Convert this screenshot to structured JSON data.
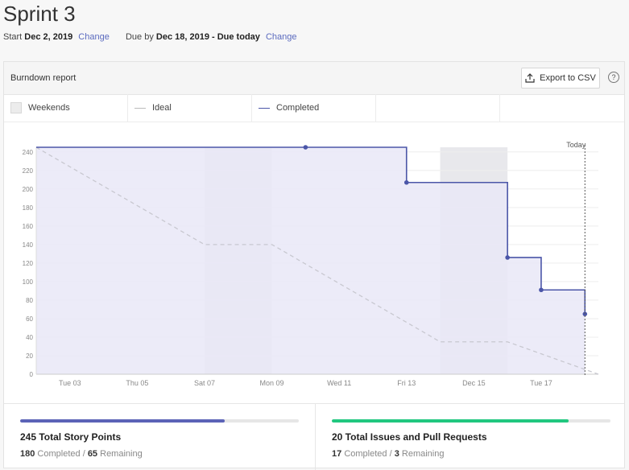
{
  "page": {
    "title": "Sprint 3",
    "start_label": "Start",
    "start_date": "Dec 2, 2019",
    "change_start": "Change",
    "due_label": "Due by",
    "due_date": "Dec 18, 2019 - Due today",
    "change_due": "Change"
  },
  "report": {
    "title": "Burndown report",
    "export_label": "Export to CSV",
    "help_glyph": "?"
  },
  "legend": {
    "weekends": "Weekends",
    "ideal": "Ideal",
    "completed": "Completed"
  },
  "chart_data": {
    "type": "line",
    "today_label": "Today",
    "ylim": [
      0,
      245
    ],
    "y_ticks": [
      0,
      20,
      40,
      60,
      80,
      100,
      120,
      140,
      160,
      180,
      200,
      220,
      240
    ],
    "x_tick_labels": [
      "Tue 03",
      "Thu 05",
      "Sat 07",
      "Mon 09",
      "Wed 11",
      "Fri 13",
      "Dec 15",
      "Tue 17"
    ],
    "x_tick_days": [
      1,
      3,
      5,
      7,
      9,
      11,
      13,
      15
    ],
    "x_range_days": [
      0,
      16.7
    ],
    "today_day": 16.3,
    "weekends": [
      [
        5,
        7
      ],
      [
        12,
        14
      ]
    ],
    "ideal": {
      "name": "Ideal",
      "points": [
        [
          0,
          245
        ],
        [
          5,
          140
        ],
        [
          7,
          140
        ],
        [
          12,
          35
        ],
        [
          14,
          35
        ],
        [
          16.7,
          0
        ]
      ]
    },
    "completed": {
      "name": "Completed",
      "steps": [
        [
          0,
          245
        ],
        [
          8,
          245
        ],
        [
          11,
          245
        ],
        [
          11,
          207
        ],
        [
          14,
          207
        ],
        [
          14,
          126
        ],
        [
          15,
          126
        ],
        [
          15,
          91
        ],
        [
          16,
          91
        ],
        [
          16.3,
          91
        ],
        [
          16.3,
          65
        ]
      ],
      "markers": [
        [
          8,
          245
        ],
        [
          11,
          207
        ],
        [
          14,
          126
        ],
        [
          15,
          91
        ],
        [
          16.3,
          65
        ]
      ]
    },
    "colors": {
      "completed": "#4b56a8",
      "completed_fill": "#e9e8f7",
      "ideal": "#c8c8d0",
      "weekend": "#e0e0e6"
    }
  },
  "stats": {
    "story_points": {
      "headline": "245 Total Story Points",
      "completed": "180",
      "completed_label": "Completed",
      "separator": "/",
      "remaining": "65",
      "remaining_label": "Remaining",
      "progress": 0.735,
      "color": "#5b63b7"
    },
    "issues": {
      "headline": "20 Total Issues and Pull Requests",
      "completed": "17",
      "completed_label": "Completed",
      "separator": "/",
      "remaining": "3",
      "remaining_label": "Remaining",
      "progress": 0.85,
      "color": "#21c77f"
    }
  }
}
